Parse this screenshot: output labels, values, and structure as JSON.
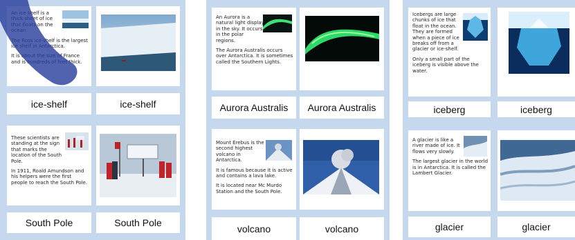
{
  "cards": [
    {
      "id": "ice-shelf",
      "label": "ice-shelf",
      "text": [
        "An ice shelf is a thick sheet of ice that floats on the ocean.",
        "The Ross ice-shelf is the largest ice shelf in Antarctica.",
        "It is about the size of France and is hundreds of feet thick."
      ]
    },
    {
      "id": "south-pole",
      "label": "South Pole",
      "text": [
        "These scientists are standing at the sign that marks the location of the South Pole.",
        "In 1911, Roald Amundson and his helpers were the first people to reach the South Pole."
      ]
    },
    {
      "id": "aurora",
      "label": "Aurora Australis",
      "text": [
        "An Aurora is a natural light display in the sky. It occurs in the polar regions.",
        "The Aurora Australis occurs over Antarctica. It is sometimes called the Southern Lights."
      ]
    },
    {
      "id": "volcano",
      "label": "volcano",
      "text": [
        "Mount Erebus is the second highest volcano in Antarctica.",
        "It is famous because it is active and contains a lava lake.",
        "It is located near Mc Murdo Station and the South Pole."
      ]
    },
    {
      "id": "iceberg",
      "label": "iceberg",
      "text": [
        "Icebergs are large chunks of ice that float in the ocean. They are formed when a piece of ice breaks off from a glacier or ice-shelf.",
        "Only a small part of the iceberg is visible above the water."
      ]
    },
    {
      "id": "glacier",
      "label": "glacier",
      "text": [
        "A glacier is like a river made of ice. It flows very slowly.",
        "The largest glacier in the world is in Antarctica. It is called the Lambert Glacier."
      ]
    }
  ],
  "colors": {
    "page_bg": "#c6d8ee",
    "watermark": "#2b3f9e"
  }
}
